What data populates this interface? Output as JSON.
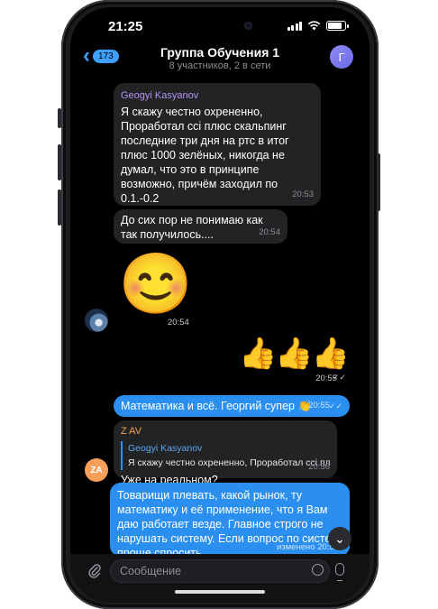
{
  "status_bar": {
    "time": "21:25"
  },
  "header": {
    "back_count": "173",
    "title": "Группа Обучения 1",
    "subtitle": "8 участников, 2 в сети",
    "avatar_letter": "Г"
  },
  "messages": {
    "m1": {
      "sender": "Geogyi Kasyanov",
      "text": "Я скажу честно охрененно, Проработал ссі плюс скальпинг последние три дня на ртс в итог плюс 1000 зелёных, никогда не думал, что это в принципе возможно, причём заходил по 0.1.-0.2",
      "reactions": [
        "🔥",
        "🌚"
      ],
      "time": "20:53"
    },
    "m2": {
      "text": "До сих пор не понимаю как так получилось....",
      "time": "20:54"
    },
    "m3": {
      "emoji": "😊",
      "time": "20:54"
    },
    "m4": {
      "emoji": "👍👍👍",
      "time": "20:55"
    },
    "m5": {
      "text": "Математика и всё. Георгий супер",
      "emoji": "👏",
      "time": "20:55"
    },
    "m6": {
      "sender": "Z AV",
      "avatar": "ZA",
      "reply_name": "Geogyi Kasyanov",
      "reply_text": "Я скажу честно охрененно, Проработал ссі пл",
      "text": "Уже на реальном?",
      "time": "20:56"
    },
    "m7": {
      "text": "Товарищи плевать, какой рынок, ту математику и её применение, что я Вам даю работает везде. Главное строго не нарушать систему. Если вопрос по систем проще спросить.",
      "meta": "изменено 20:57"
    }
  },
  "input": {
    "placeholder": "Сообщение"
  },
  "icons": {
    "back": "chevron-left-icon",
    "attach": "paperclip-icon",
    "sticker": "sticker-icon",
    "mic": "microphone-icon",
    "scroll": "chevron-down-icon"
  },
  "colors": {
    "accent": "#2b8ff0",
    "incoming": "#222325",
    "sender_purple": "#b493f5",
    "sender_orange": "#f2a155"
  }
}
